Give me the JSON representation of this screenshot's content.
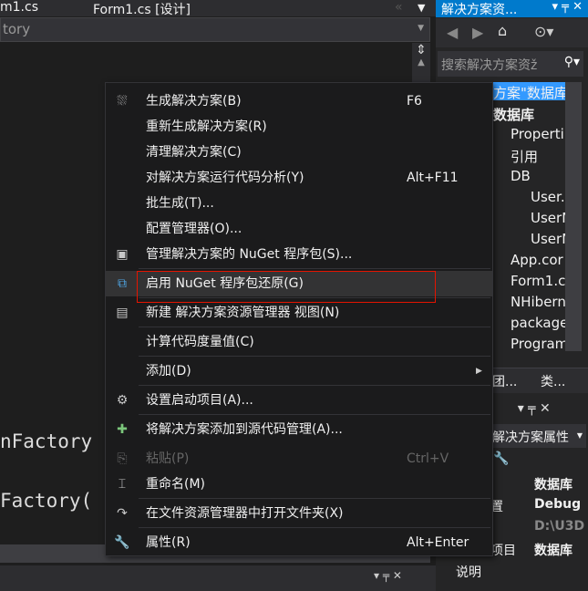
{
  "editor": {
    "tabs": [
      "m1.cs",
      "Form1.cs [设计]"
    ],
    "nav_dropdown": "tory",
    "code_lines": [
      "nFactory",
      "Factory("
    ]
  },
  "solution_explorer": {
    "title": "解决方案资...",
    "search_placeholder": "搜索解决方案资ž",
    "tree": [
      {
        "label": "方案\"数据库",
        "selected": true
      },
      {
        "label": "数据库"
      },
      {
        "label": "Properti"
      },
      {
        "label": "引用"
      },
      {
        "label": "DB"
      },
      {
        "label": "User."
      },
      {
        "label": "UserN"
      },
      {
        "label": "UserN"
      },
      {
        "label": "App.cor"
      },
      {
        "label": "Form1.c"
      },
      {
        "label": "NHibern"
      },
      {
        "label": "package"
      },
      {
        "label": "Program"
      }
    ],
    "bottom_tabs": [
      "团...",
      "类..."
    ]
  },
  "properties": {
    "object_selector": "解决方案属性",
    "rows": [
      {
        "name": "",
        "value": "数据库"
      },
      {
        "name": "置",
        "value": "Debug"
      },
      {
        "name": "",
        "value": "D:\\U3D"
      },
      {
        "name": "项目",
        "value": "数据库"
      },
      {
        "name": "说明",
        "value": ""
      }
    ]
  },
  "context_menu": {
    "items": [
      {
        "label": "生成解决方案(B)",
        "shortcut": "F6",
        "icon": "build-icon"
      },
      {
        "label": "重新生成解决方案(R)",
        "shortcut": ""
      },
      {
        "label": "清理解决方案(C)",
        "shortcut": ""
      },
      {
        "label": "对解决方案运行代码分析(Y)",
        "shortcut": "Alt+F11"
      },
      {
        "label": "批生成(T)...",
        "shortcut": ""
      },
      {
        "label": "配置管理器(O)...",
        "shortcut": ""
      },
      {
        "label": "管理解决方案的 NuGet 程序包(S)...",
        "shortcut": "",
        "icon": "nuget-icon"
      },
      {
        "label": "启用 NuGet 程序包还原(G)",
        "shortcut": "",
        "icon": "package-restore-icon",
        "highlighted": true
      },
      {
        "label": "新建 解决方案资源管理器 视图(N)",
        "shortcut": "",
        "icon": "new-view-icon"
      },
      {
        "label": "计算代码度量值(C)",
        "shortcut": ""
      },
      {
        "label": "添加(D)",
        "shortcut": "",
        "submenu": true
      },
      {
        "label": "设置启动项目(A)...",
        "shortcut": "",
        "icon": "gear-icon"
      },
      {
        "label": "将解决方案添加到源代码管理(A)...",
        "shortcut": "",
        "icon": "source-control-icon"
      },
      {
        "label": "粘贴(P)",
        "shortcut": "Ctrl+V",
        "icon": "paste-icon",
        "disabled": true
      },
      {
        "label": "重命名(M)",
        "shortcut": "",
        "icon": "rename-icon"
      },
      {
        "label": "在文件资源管理器中打开文件夹(X)",
        "shortcut": "",
        "icon": "redo-arrow-icon"
      },
      {
        "label": "属性(R)",
        "shortcut": "Alt+Enter",
        "icon": "wrench-icon"
      }
    ]
  },
  "colors": {
    "accent": "#007acc",
    "highlight_box": "#e51400"
  }
}
